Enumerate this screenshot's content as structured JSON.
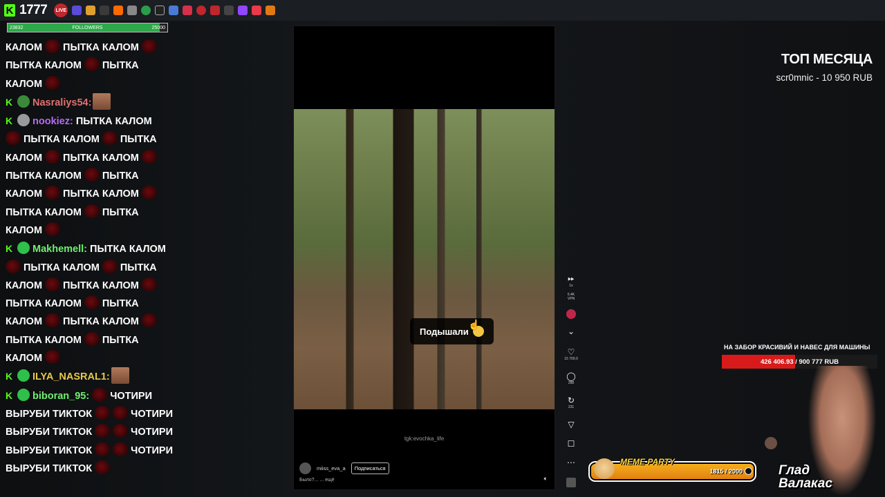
{
  "topbar": {
    "viewer_count": "1777",
    "live_label": "LIVE"
  },
  "followers_goal": {
    "label": "FOLLOWERS",
    "current": "23832",
    "target": "25000",
    "progress": 0.953
  },
  "chat": {
    "messages": [
      {
        "user": "",
        "text": "КАЛОМ",
        "cont": "ПЫТКА КАЛОМ"
      },
      {
        "user": "",
        "text": "ПЫТКА КАЛОМ",
        "cont": "ПЫТКА"
      },
      {
        "user": "",
        "text": "КАЛОМ",
        "cont": ""
      },
      {
        "user": "Nasraliys54:",
        "text": ""
      },
      {
        "user": "nookiez:",
        "text": "ПЫТКА КАЛОМ"
      },
      {
        "user": "Makhemell:",
        "text": "ПЫТКА КАЛОМ"
      },
      {
        "user": "ILYA_NASRAL1:",
        "text": ""
      },
      {
        "user": "biboran_95:",
        "text": "ЧОТИРИ"
      }
    ],
    "lines": {
      "l1a": "КАЛОМ",
      "l1b": "ПЫТКА КАЛОМ",
      "l2a": "ПЫТКА КАЛОМ",
      "l2b": "ПЫТКА",
      "l3a": "КАЛОМ",
      "u_nasraliys": "Nasraliys54:",
      "u_nookiez": "nookiez:",
      "nookiez_text": "ПЫТКА КАЛОМ",
      "n1a": "ПЫТКА КАЛОМ",
      "n1b": "ПЫТКА",
      "n2a": "КАЛОМ",
      "n2b": "ПЫТКА КАЛОМ",
      "n3a": "ПЫТКА КАЛОМ",
      "n3b": "ПЫТКА",
      "n4a": "КАЛОМ",
      "n4b": "ПЫТКА КАЛОМ",
      "n5a": "ПЫТКА КАЛОМ",
      "n5b": "ПЫТКА",
      "n6a": "КАЛОМ",
      "u_makhemell": "Makhemell:",
      "makhemell_text": "ПЫТКА КАЛОМ",
      "m1a": "ПЫТКА КАЛОМ",
      "m1b": "ПЫТКА",
      "m2a": "КАЛОМ",
      "m2b": "ПЫТКА КАЛОМ",
      "m3a": "ПЫТКА КАЛОМ",
      "m3b": "ПЫТКА",
      "m4a": "КАЛОМ",
      "m4b": "ПЫТКА КАЛОМ",
      "m5a": "ПЫТКА КАЛОМ",
      "m5b": "ПЫТКА",
      "m6a": "КАЛОМ",
      "u_ilya": "ILYA_NASRAL1:",
      "u_biboran": "biboran_95:",
      "biboran_text": "ЧОТИРИ",
      "b1a": "ВЫРУБИ ТИКТОК",
      "b1b": "ЧОТИРИ",
      "b2a": "ВЫРУБИ ТИКТОК",
      "b2b": "ЧОТИРИ",
      "b3a": "ВЫРУБИ ТИКТОК",
      "b3b": "ЧОТИРИ",
      "b4a": "ВЫРУБИ ТИКТОК"
    }
  },
  "video": {
    "caption": "Подышали",
    "watermark": "tgk:evochka_life",
    "author": "miiss_eva_a",
    "subscribe_label": "Подписаться",
    "description": "Было?... ... ещё"
  },
  "side_controls": {
    "speed": "1x",
    "stat1": "6.4K",
    "stat1_sub": "VPN",
    "likes": "15 700,0",
    "comments": "288",
    "reposts": "231"
  },
  "top_month": {
    "title": "ТОП МЕСЯЦА",
    "entry": "scr0mnic - 10 950 RUB"
  },
  "donation_goal": {
    "title": "НА ЗАБОР КРАСИВИЙ И НАВЕС ДЛЯ МАШИНЫ",
    "text": "426 406.93 / 900 777 RUB",
    "progress": 0.473
  },
  "meme_party": {
    "title": "MEME PARTY",
    "count": "1815 / 2000"
  },
  "streamer": {
    "name_line1": "Глад",
    "name_line2": "Валакас"
  }
}
